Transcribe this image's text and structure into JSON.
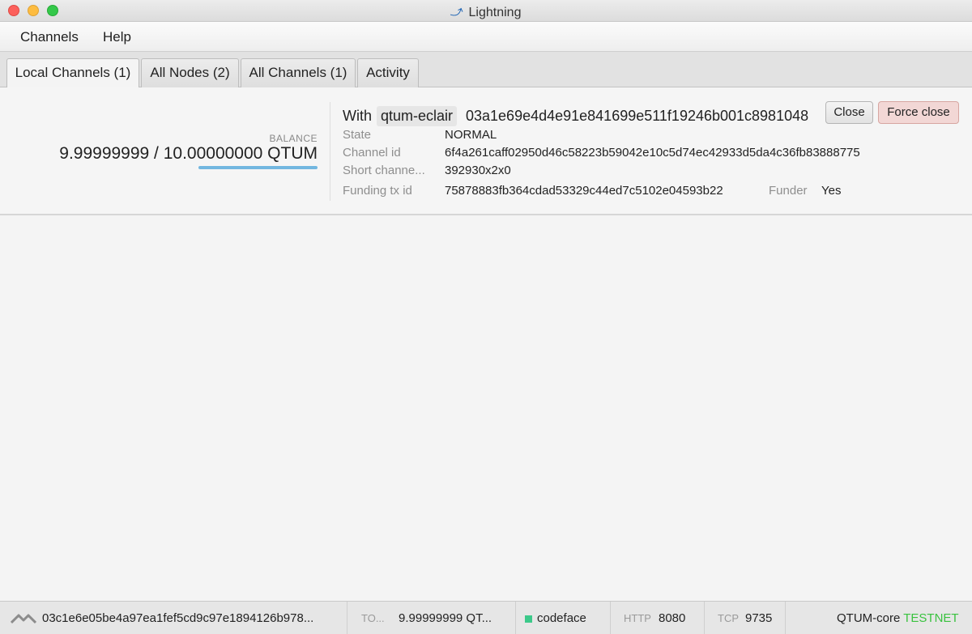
{
  "window": {
    "title": "Lightning"
  },
  "menu": {
    "items": [
      "Channels",
      "Help"
    ]
  },
  "tabs": [
    {
      "label": "Local Channels (1)",
      "active": true
    },
    {
      "label": "All Nodes (2)",
      "active": false
    },
    {
      "label": "All Channels (1)",
      "active": false
    },
    {
      "label": "Activity",
      "active": false
    }
  ],
  "channel": {
    "balance_label": "BALANCE",
    "balance_value": "9.99999999 / 10.00000000 QTUM",
    "balance_fraction": 0.999999999,
    "with_label": "With",
    "node_alias": "qtum-eclair",
    "node_id": "03a1e69e4d4e91e841699e511f19246b001c8981048",
    "close_label": "Close",
    "force_close_label": "Force close",
    "details": [
      {
        "label": "State",
        "value": "NORMAL"
      },
      {
        "label": "Channel id",
        "value": "6f4a261caff02950d46c58223b59042e10c5d74ec42933d5da4c36fb83888775"
      },
      {
        "label": "Short channe...",
        "value": "392930x2x0"
      },
      {
        "label": "Funding tx id",
        "value": "75878883fb364cdad53329c44ed7c5102e04593b22"
      }
    ],
    "funder_label": "Funder",
    "funder_value": "Yes"
  },
  "status": {
    "node_id": "03c1e6e05be4a97ea1fef5cd9c97e1894126b978...",
    "total_label": "TO...",
    "total_value": "9.99999999 QT...",
    "alias": "codeface",
    "http_label": "HTTP",
    "http_port": "8080",
    "tcp_label": "TCP",
    "tcp_port": "9735",
    "backend": "QTUM-core",
    "network": "TESTNET"
  },
  "colors": {
    "balance_bar": "#72b7e0",
    "force_close_bg": "#f2d7d5",
    "network_text": "#39c23f",
    "status_dot": "#3cc98a"
  },
  "icons": [
    "app-lightning-icon",
    "connection-icon",
    "status-indicator-icon"
  ]
}
